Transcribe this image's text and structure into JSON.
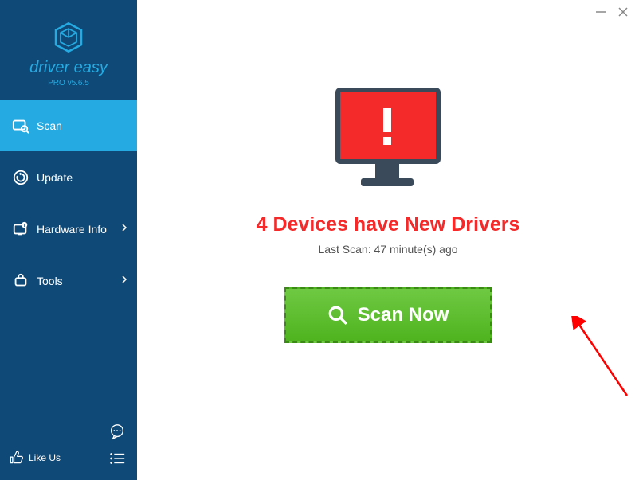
{
  "titlebar": {
    "minimize": "—",
    "close": "×"
  },
  "sidebar": {
    "brand": "driver easy",
    "version": "PRO v5.6.5",
    "items": [
      {
        "label": "Scan",
        "active": true,
        "hasChevron": false
      },
      {
        "label": "Update",
        "active": false,
        "hasChevron": false
      },
      {
        "label": "Hardware Info",
        "active": false,
        "hasChevron": true
      },
      {
        "label": "Tools",
        "active": false,
        "hasChevron": true
      }
    ],
    "likeUs": "Like Us"
  },
  "main": {
    "headline": "4 Devices have New Drivers",
    "lastScan": "Last Scan: 47 minute(s) ago",
    "scanButton": "Scan Now"
  },
  "colors": {
    "sidebarBg": "#0e4977",
    "accent": "#25aae1",
    "alertRed": "#f42a2a",
    "buttonGreen": "#4eb31e"
  }
}
